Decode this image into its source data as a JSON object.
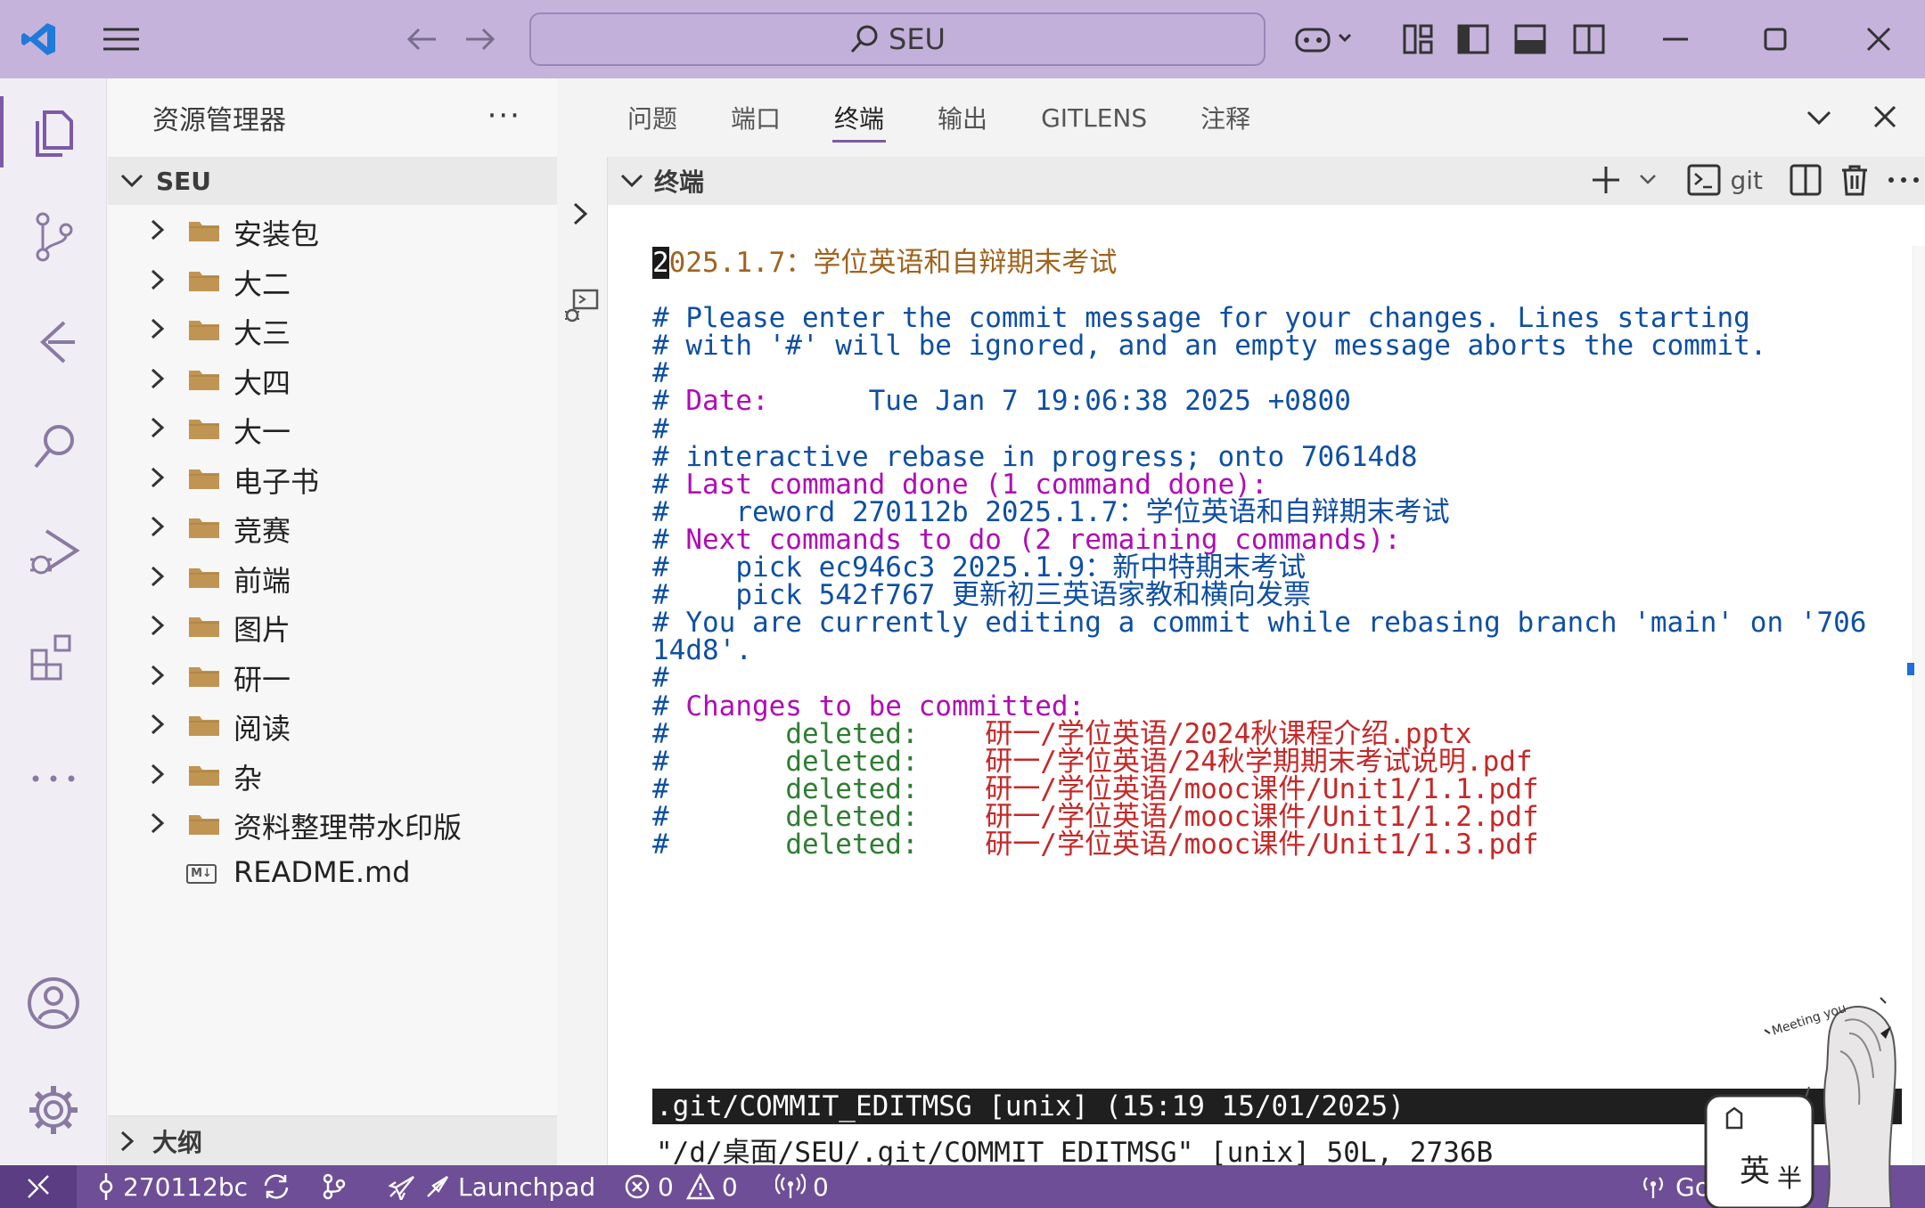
{
  "titlebar": {
    "search_text": "SEU"
  },
  "activity_bar": {
    "items": [
      "explorer-icon",
      "source-control-icon",
      "gitlens-icon",
      "search-icon",
      "run-debug-icon",
      "extensions-icon",
      "more-icon",
      "account-icon",
      "settings-icon"
    ]
  },
  "sidebar": {
    "title": "资源管理器",
    "more": "···",
    "section": "SEU",
    "items": [
      {
        "label": "安装包",
        "type": "folder"
      },
      {
        "label": "大二",
        "type": "folder"
      },
      {
        "label": "大三",
        "type": "folder"
      },
      {
        "label": "大四",
        "type": "folder"
      },
      {
        "label": "大一",
        "type": "folder"
      },
      {
        "label": "电子书",
        "type": "folder"
      },
      {
        "label": "竞赛",
        "type": "folder"
      },
      {
        "label": "前端",
        "type": "folder"
      },
      {
        "label": "图片",
        "type": "folder"
      },
      {
        "label": "研一",
        "type": "folder"
      },
      {
        "label": "阅读",
        "type": "folder"
      },
      {
        "label": "杂",
        "type": "folder"
      },
      {
        "label": "资料整理带水印版",
        "type": "folder"
      },
      {
        "label": "README.md",
        "type": "markdown"
      }
    ],
    "outline": "大纲"
  },
  "panel": {
    "tabs": [
      "问题",
      "端口",
      "终端",
      "输出",
      "GITLENS",
      "注释"
    ],
    "active_tab": "终端",
    "terminal_title": "终端",
    "terminal_profile": "git"
  },
  "terminal": {
    "title_line_num": "2",
    "title_line_rest": "025.1.7：学位英语和自辩期末考试",
    "lines": [
      {
        "cls": "c-cm",
        "text": ""
      },
      {
        "cls": "c-cm",
        "text": "# Please enter the commit message for your changes. Lines starting"
      },
      {
        "cls": "c-cm",
        "text": "# with '#' will be ignored, and an empty message aborts the commit."
      },
      {
        "cls": "c-cm",
        "text": "#"
      },
      {
        "cls": "c-cm",
        "text": "# "
      },
      {
        "cls": "c-cm",
        "text": "#"
      },
      {
        "cls": "c-cm",
        "text": "# interactive rebase in progress; onto 70614d8"
      },
      {
        "cls": "c-cm",
        "text": "# "
      },
      {
        "cls": "c-cm",
        "text": "#    reword 270112b 2025.1.7：学位英语和自辩期末考试"
      },
      {
        "cls": "c-cm",
        "text": "# "
      },
      {
        "cls": "c-cm",
        "text": "#    pick ec946c3 2025.1.9：新中特期末考试"
      },
      {
        "cls": "c-cm",
        "text": "#    pick 542f767 更新初三英语家教和横向发票"
      },
      {
        "cls": "c-cm",
        "text": "# You are currently editing a commit while rebasing branch 'main' on '706"
      },
      {
        "cls": "c-cm",
        "text": "14d8'."
      },
      {
        "cls": "c-cm",
        "text": "#"
      },
      {
        "cls": "c-cm",
        "text": "# "
      },
      {
        "cls": "c-cm",
        "text": "#       "
      },
      {
        "cls": "c-cm",
        "text": "#       "
      },
      {
        "cls": "c-cm",
        "text": "#       "
      },
      {
        "cls": "c-cm",
        "text": "#       "
      },
      {
        "cls": "c-cm",
        "text": "#       "
      }
    ],
    "date_label": "Date:",
    "date_value": "      Tue Jan 7 19:06:38 2025 +0800",
    "last_cmd_label": "Last command done (1 command done):",
    "next_cmd_label": "Next commands to do (2 remaining commands):",
    "changes_label": "Changes to be committed:",
    "deleted_label": "deleted:",
    "deleted_paths": [
      "研一/学位英语/2024秋课程介绍.pptx",
      "研一/学位英语/24秋学期期末考试说明.pdf",
      "研一/学位英语/mooc课件/Unit1/1.1.pdf",
      "研一/学位英语/mooc课件/Unit1/1.2.pdf",
      "研一/学位英语/mooc课件/Unit1/1.3.pdf"
    ],
    "vim_status": ".git/COMMIT_EDITMSG [unix] (15:19 15/01/2025)",
    "file_info": "\"/d/桌面/SEU/.git/COMMIT_EDITMSG\" [unix] 50L, 2736B"
  },
  "statusbar": {
    "branch": "270112bc",
    "launchpad": "Launchpad",
    "errors": "0",
    "warnings": "0",
    "ports": "0",
    "right_text": "Go"
  },
  "mascot": {
    "text_1": "英",
    "text_2": "半",
    "caption": "Meeting you"
  },
  "colors": {
    "titlebar": "#c5b3dc",
    "statusbar": "#6e4e96",
    "accent": "#7c5aa8",
    "comment": "#0e4fa3",
    "keyword": "#b00cb5",
    "path": "#c62828"
  }
}
